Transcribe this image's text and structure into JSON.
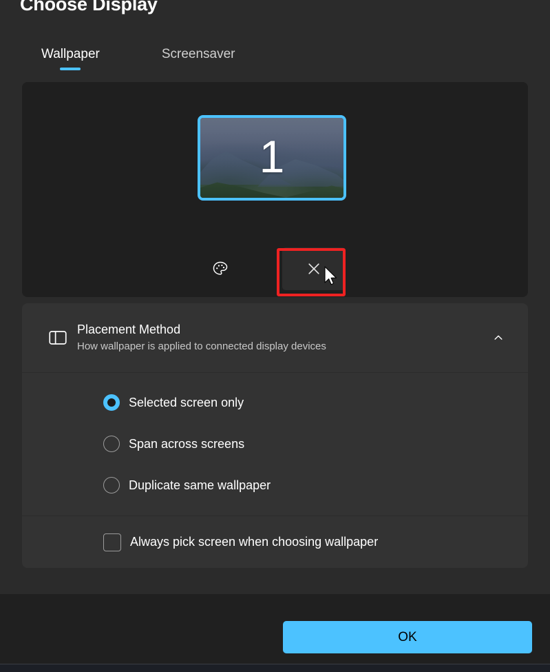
{
  "window": {
    "title": "Choose Display"
  },
  "tabs": [
    {
      "label": "Wallpaper",
      "active": true
    },
    {
      "label": "Screensaver",
      "active": false
    }
  ],
  "preview": {
    "monitor": {
      "number": "1",
      "selected": true,
      "wallpaper_description": "mountain landscape"
    },
    "actions": [
      {
        "name": "palette-icon",
        "label": ""
      },
      {
        "name": "close-icon",
        "label": ""
      }
    ]
  },
  "annotation": {
    "color": "#ee2222",
    "target": "close-icon"
  },
  "placement": {
    "icon": "layout-panel-icon",
    "title": "Placement Method",
    "subtitle": "How wallpaper is applied to connected display devices",
    "expanded": true,
    "chevron_icon": "chevron-up-icon",
    "options": [
      {
        "label": "Selected screen only",
        "checked": true
      },
      {
        "label": "Span across screens",
        "checked": false
      },
      {
        "label": "Duplicate same wallpaper",
        "checked": false
      }
    ],
    "checkbox": {
      "label": "Always pick screen when choosing wallpaper",
      "checked": false
    }
  },
  "footer": {
    "ok_label": "OK"
  },
  "colors": {
    "accent": "#4cc2ff",
    "page_background": "#2b2b2b",
    "preview_background": "#1f1f1f",
    "card_background": "#333333",
    "footer_background": "#202020",
    "annotation_red": "#ee2222"
  }
}
